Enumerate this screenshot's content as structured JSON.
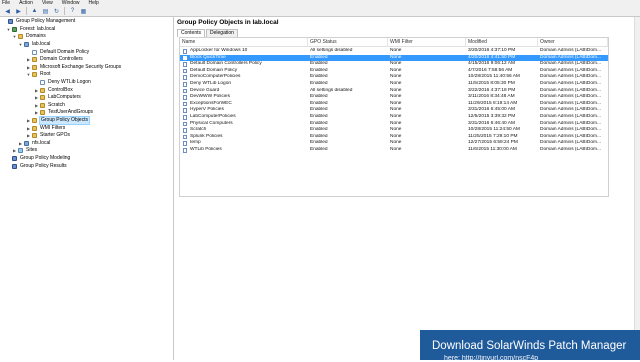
{
  "menu": [
    "File",
    "Action",
    "View",
    "Window",
    "Help"
  ],
  "toolbar": {
    "buttons": [
      "back-icon",
      "forward-icon",
      "up-icon",
      "show-hide-tree-icon",
      "refresh-icon",
      "help-icon",
      "properties-icon"
    ]
  },
  "tree": [
    {
      "label": "Group Policy Management",
      "icon": "gpm",
      "exp": ""
    },
    {
      "label": "Forest: lab.local",
      "icon": "forest",
      "exp": "▼"
    },
    {
      "label": "Domains",
      "icon": "folder",
      "exp": "▼"
    },
    {
      "label": "lab.local",
      "icon": "domain",
      "exp": "▼"
    },
    {
      "label": "Default Domain Policy",
      "icon": "gpo",
      "exp": ""
    },
    {
      "label": "Domain Controllers",
      "icon": "ou",
      "exp": "▶"
    },
    {
      "label": "Microsoft Exchange Security Groups",
      "icon": "ou",
      "exp": "▶"
    },
    {
      "label": "Root",
      "icon": "ou",
      "exp": "▼"
    },
    {
      "label": "Deny WTLib Logon",
      "icon": "gpo",
      "exp": ""
    },
    {
      "label": "ControlBox",
      "icon": "ou",
      "exp": "▶"
    },
    {
      "label": "LabComputers",
      "icon": "ou",
      "exp": "▶"
    },
    {
      "label": "Scratch",
      "icon": "ou",
      "exp": "▶"
    },
    {
      "label": "TestUserAndGroups",
      "icon": "ou",
      "exp": "▶"
    },
    {
      "label": "Group Policy Objects",
      "icon": "folder",
      "exp": "▶",
      "selected": true
    },
    {
      "label": "WMI Filters",
      "icon": "folder",
      "exp": "▶"
    },
    {
      "label": "Starter GPOs",
      "icon": "folder",
      "exp": "▶"
    },
    {
      "label": "nfs.local",
      "icon": "domain",
      "exp": "▶"
    },
    {
      "label": "Sites",
      "icon": "site",
      "exp": "▶"
    },
    {
      "label": "Group Policy Modeling",
      "icon": "gpm",
      "exp": ""
    },
    {
      "label": "Group Policy Results",
      "icon": "gpm",
      "exp": ""
    }
  ],
  "pane": {
    "title": "Group Policy Objects in lab.local",
    "tabs": [
      "Contents",
      "Delegation"
    ],
    "columns": [
      "Name",
      "GPO Status",
      "WMI Filter",
      "Modified",
      "Owner"
    ],
    "rows": [
      [
        "AppLocker for Windows 10",
        "All settings disabled",
        "None",
        "3/20/2016 4:37:10 PM",
        "Domain Admins (LAB\\Dom..."
      ],
      [
        "Block QuickTime",
        "Enabled",
        "None",
        "4/20/2016 4:41:50 PM",
        "Domain Admins (LAB\\Dom..."
      ],
      [
        "Default Domain Controllers Policy",
        "Enabled",
        "None",
        "4/15/2016 9:06:12 AM",
        "Domain Admins (LAB\\Dom..."
      ],
      [
        "Default Domain Policy",
        "Enabled",
        "None",
        "4/7/2016 7:58:56 AM",
        "Domain Admins (LAB\\Dom..."
      ],
      [
        "DemoComputerPolicies",
        "Enabled",
        "None",
        "10/28/2015 11:40:56 AM",
        "Domain Admins (LAB\\Dom..."
      ],
      [
        "Deny WTLib Logon",
        "Enabled",
        "None",
        "11/5/2015 8:05:30 PM",
        "Domain Admins (LAB\\Dom..."
      ],
      [
        "Device Guard",
        "All settings disabled",
        "None",
        "3/22/2016 4:37:18 PM",
        "Domain Admins (LAB\\Dom..."
      ],
      [
        "DevWWW Policies",
        "Enabled",
        "None",
        "3/11/2016 8:34:48 AM",
        "Domain Admins (LAB\\Dom..."
      ],
      [
        "ExceptionsForWEC",
        "Enabled",
        "None",
        "11/29/2015 8:19:14 AM",
        "Domain Admins (LAB\\Dom..."
      ],
      [
        "HyperV Policies",
        "Enabled",
        "None",
        "3/31/2016 6:45:00 AM",
        "Domain Admins (LAB\\Dom..."
      ],
      [
        "LabComputerPolicies",
        "Enabled",
        "None",
        "12/5/2015 3:39:32 PM",
        "Domain Admins (LAB\\Dom..."
      ],
      [
        "Physical Computers",
        "Enabled",
        "None",
        "3/31/2016 6:46:40 AM",
        "Domain Admins (LAB\\Dom..."
      ],
      [
        "Scratch",
        "Enabled",
        "None",
        "10/28/2015 11:24:50 AM",
        "Domain Admins (LAB\\Dom..."
      ],
      [
        "Splunk Policies",
        "Enabled",
        "None",
        "11/25/2015 7:29:10 PM",
        "Domain Admins (LAB\\Dom..."
      ],
      [
        "temp",
        "Enabled",
        "None",
        "12/27/2015 6:59:24 PM",
        "Domain Admins (LAB\\Dom..."
      ],
      [
        "WTLib Policies",
        "Enabled",
        "None",
        "11/6/2015 11:30:00 AM",
        "Domain Admins (LAB\\Dom..."
      ]
    ],
    "selected_row": 1
  },
  "banner": {
    "title": "Download SolarWinds Patch Manager",
    "subtitle": "here: http://tinyurl.com/nscF4p"
  },
  "colors": {
    "selection": "#3399ff",
    "banner": "#1f5a9b"
  }
}
